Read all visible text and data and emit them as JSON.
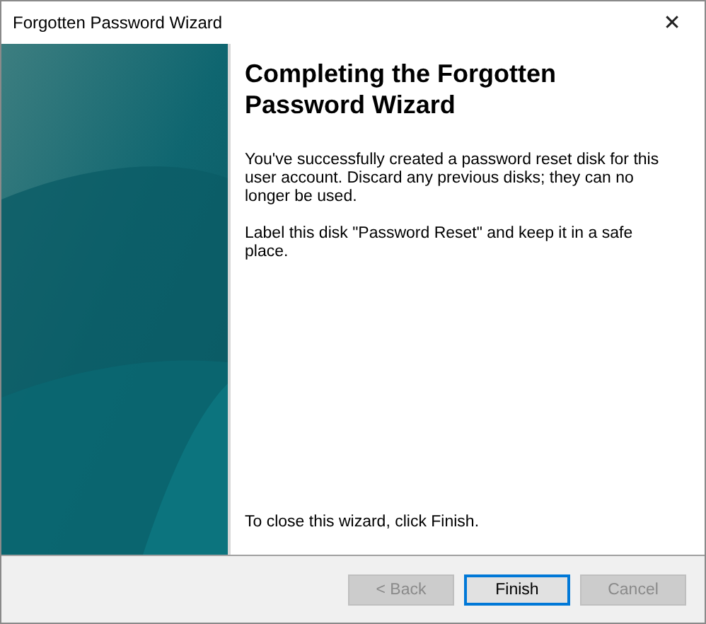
{
  "window": {
    "title": "Forgotten Password Wizard",
    "close": "✕"
  },
  "heading": "Completing the Forgotten Password Wizard",
  "paragraphs": [
    "You've successfully created a password reset disk for this user account. Discard any previous disks; they can no longer be used.",
    "Label this disk \"Password Reset\" and keep it in a safe place."
  ],
  "closing_hint": "To close this wizard, click Finish.",
  "buttons": [
    {
      "label": "< Back",
      "disabled": true,
      "default": false
    },
    {
      "label": "Finish",
      "disabled": false,
      "default": true
    },
    {
      "label": "Cancel",
      "disabled": true,
      "default": false
    }
  ]
}
